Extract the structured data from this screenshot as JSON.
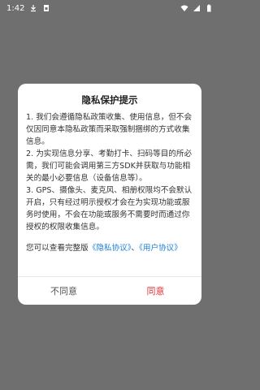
{
  "status_bar": {
    "time": "1:42",
    "icons": [
      "download-icon",
      "sim-icon",
      "wifi-icon",
      "signal-icon",
      "battery-icon"
    ]
  },
  "dialog": {
    "title": "隐私保护提示",
    "paragraphs": [
      "1. 我们会遵循隐私政策收集、使用信息，但不会仅因同意本隐私政策而采取强制捆绑的方式收集信息。",
      "2. 为实现信息分享、考勤打卡、扫码等目的所必需，我们可能会调用第三方SDK并获取与功能相关的最小必要信息（设备信息等）。",
      "3. GPS、摄像头、麦克风、相册权限均不会默认开启，只有经过明示授权才会在为实现功能或服务时使用，不会在功能或服务不需要时而通过你授权的权限收集信息。"
    ],
    "agreement_prefix": "您可以查看完整版",
    "privacy_link": "《隐私协议》",
    "separator": "、",
    "user_link": "《用户协议》",
    "disagree_label": "不同意",
    "agree_label": "同意"
  },
  "colors": {
    "overlay": "#6f6f6f",
    "link": "#1e7fd6",
    "agree": "#e0312f"
  }
}
